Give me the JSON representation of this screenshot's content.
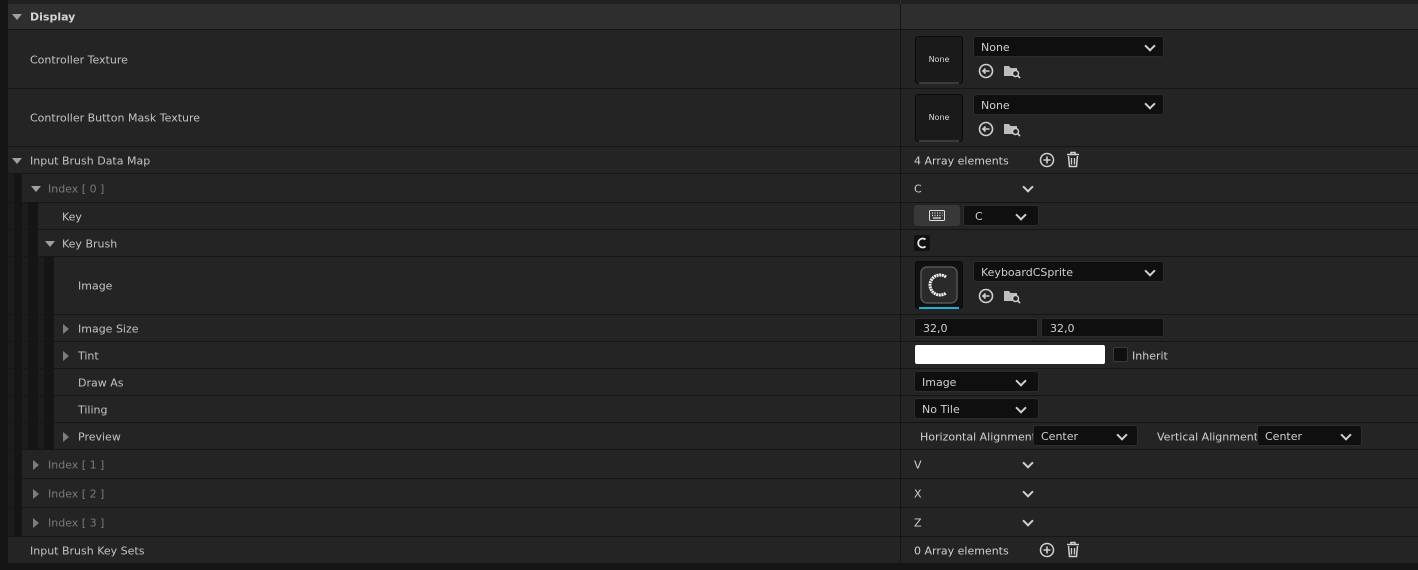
{
  "display": {
    "section_label": "Display",
    "controller_texture": {
      "label": "Controller Texture",
      "thumb": "None",
      "asset": "None"
    },
    "controller_button_mask_texture": {
      "label": "Controller Button Mask Texture",
      "thumb": "None",
      "asset": "None"
    }
  },
  "input_brush_data_map": {
    "label": "Input Brush Data Map",
    "count": "4 Array elements",
    "index0": {
      "label": "Index [ 0 ]",
      "value": "C",
      "key": {
        "label": "Key",
        "value": "C",
        "icon": "keyboard-icon"
      },
      "key_brush": {
        "label": "Key Brush",
        "image": {
          "label": "Image",
          "asset": "KeyboardCSprite"
        },
        "image_size": {
          "label": "Image Size",
          "x": "32,0",
          "y": "32,0"
        },
        "tint": {
          "label": "Tint",
          "inherit_label": "Inherit",
          "color": "#ffffff"
        },
        "draw_as": {
          "label": "Draw As",
          "value": "Image"
        },
        "tiling": {
          "label": "Tiling",
          "value": "No Tile"
        },
        "preview": {
          "label": "Preview",
          "h_align_label": "Horizontal Alignment",
          "h_align_value": "Center",
          "v_align_label": "Vertical Alignment",
          "v_align_value": "Center"
        }
      }
    },
    "index1": {
      "label": "Index [ 1 ]",
      "value": "V"
    },
    "index2": {
      "label": "Index [ 2 ]",
      "value": "X"
    },
    "index3": {
      "label": "Index [ 3 ]",
      "value": "Z"
    }
  },
  "input_brush_key_sets": {
    "label": "Input Brush Key Sets",
    "count": "0 Array elements"
  },
  "colors": {
    "accent": "#1eb2d9",
    "row_bg": "#242424",
    "field_bg": "#0f0f0f"
  }
}
